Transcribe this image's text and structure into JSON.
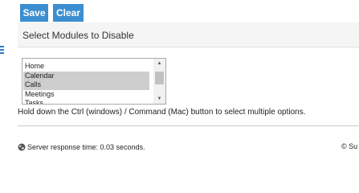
{
  "toolbar": {
    "save_label": "Save",
    "clear_label": "Clear",
    "button_color": "#3B8ED0"
  },
  "panel": {
    "title": "Select Modules to Disable"
  },
  "module_list": {
    "options": [
      {
        "label": "Home",
        "selected": false
      },
      {
        "label": "Calendar",
        "selected": true
      },
      {
        "label": "Calls",
        "selected": true
      },
      {
        "label": "Meetings",
        "selected": false
      },
      {
        "label": "Tasks",
        "selected": false
      }
    ],
    "scroll_up_icon": "triangle-up",
    "scroll_down_icon": "triangle-down"
  },
  "help": {
    "text": "Hold down the Ctrl (windows) / Command (Mac) button to select multiple options."
  },
  "footer": {
    "response_icon": "globe-icon",
    "response_text": "Server response time: 0.03 seconds.",
    "copyright_text": "© Su"
  },
  "side_menu_icon": "hamburger-icon"
}
